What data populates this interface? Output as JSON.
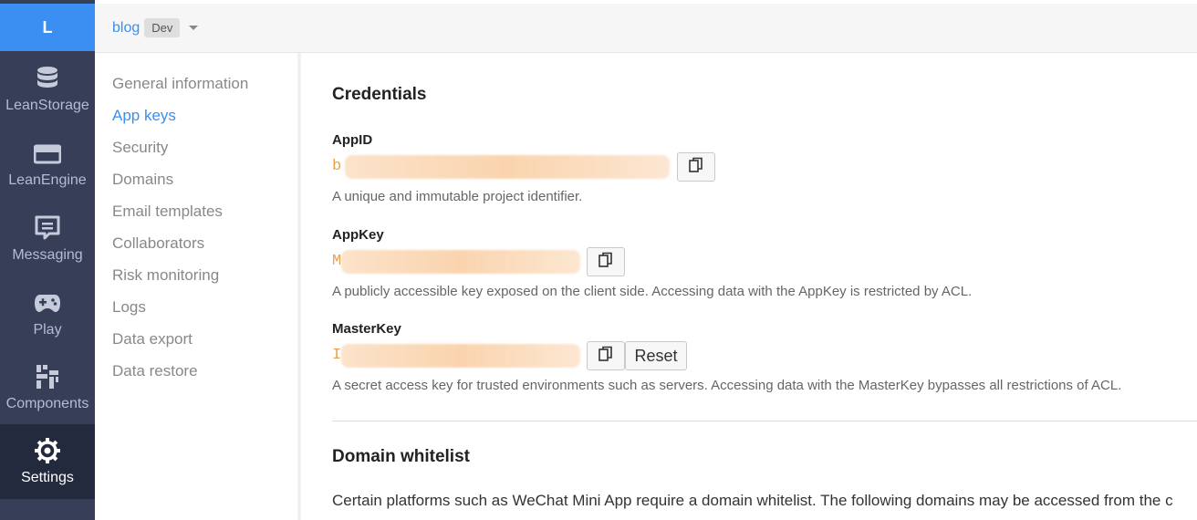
{
  "rail": {
    "logo": "L",
    "items": [
      {
        "label": "LeanStorage",
        "icon": "database-icon"
      },
      {
        "label": "LeanEngine",
        "icon": "server-icon"
      },
      {
        "label": "Messaging",
        "icon": "message-icon"
      },
      {
        "label": "Play",
        "icon": "gamepad-icon"
      },
      {
        "label": "Components",
        "icon": "components-icon"
      },
      {
        "label": "Settings",
        "icon": "gear-icon",
        "active": true
      }
    ]
  },
  "topbar": {
    "app_name": "blog",
    "env_badge": "Dev"
  },
  "submenu": {
    "items": [
      {
        "label": "General information"
      },
      {
        "label": "App keys",
        "active": true
      },
      {
        "label": "Security"
      },
      {
        "label": "Domains"
      },
      {
        "label": "Email templates"
      },
      {
        "label": "Collaborators"
      },
      {
        "label": "Risk monitoring"
      },
      {
        "label": "Logs"
      },
      {
        "label": "Data export"
      },
      {
        "label": "Data restore"
      }
    ]
  },
  "credentials": {
    "title": "Credentials",
    "appid": {
      "label": "AppID",
      "value": "b",
      "help": "A unique and immutable project identifier."
    },
    "appkey": {
      "label": "AppKey",
      "value": "M",
      "help": "A publicly accessible key exposed on the client side. Accessing data with the AppKey is restricted by ACL."
    },
    "masterkey": {
      "label": "MasterKey",
      "value": "I",
      "reset_label": "Reset",
      "help": "A secret access key for trusted environments such as servers. Accessing data with the MasterKey bypasses all restrictions of ACL."
    }
  },
  "whitelist": {
    "title": "Domain whitelist",
    "description": "Certain platforms such as WeChat Mini App require a domain whitelist. The following domains may be accessed from the c"
  },
  "colors": {
    "accent": "#3b8ef2",
    "rail_bg": "#363e58",
    "rail_active_bg": "#242a3d",
    "key_text": "#e8a24a"
  }
}
